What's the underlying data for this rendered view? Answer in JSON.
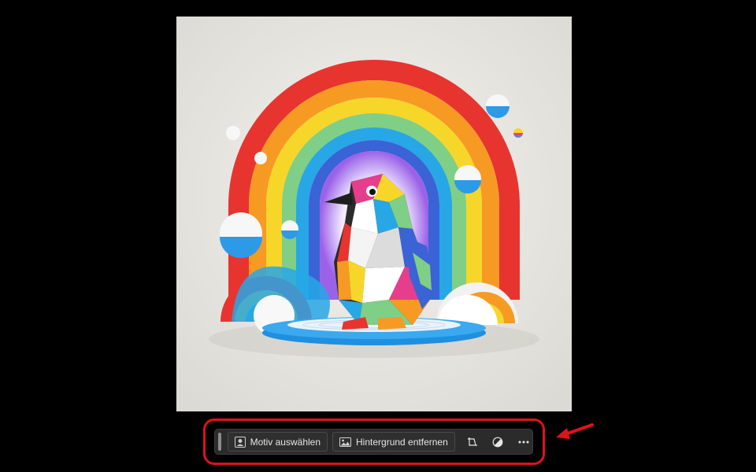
{
  "toolbar": {
    "select_subject_label": "Motiv auswählen",
    "remove_background_label": "Hintergrund entfernen",
    "select_subject_icon": "person-icon",
    "remove_background_icon": "image-icon",
    "crop_icon": "crop-icon",
    "adjust_icon": "contrast-icon",
    "more_icon": "more-horizontal-icon"
  },
  "colors": {
    "background": "#000000",
    "toolbar_bg": "#2b2b2b",
    "highlight": "#e0121b",
    "text": "#e6e6e6"
  }
}
